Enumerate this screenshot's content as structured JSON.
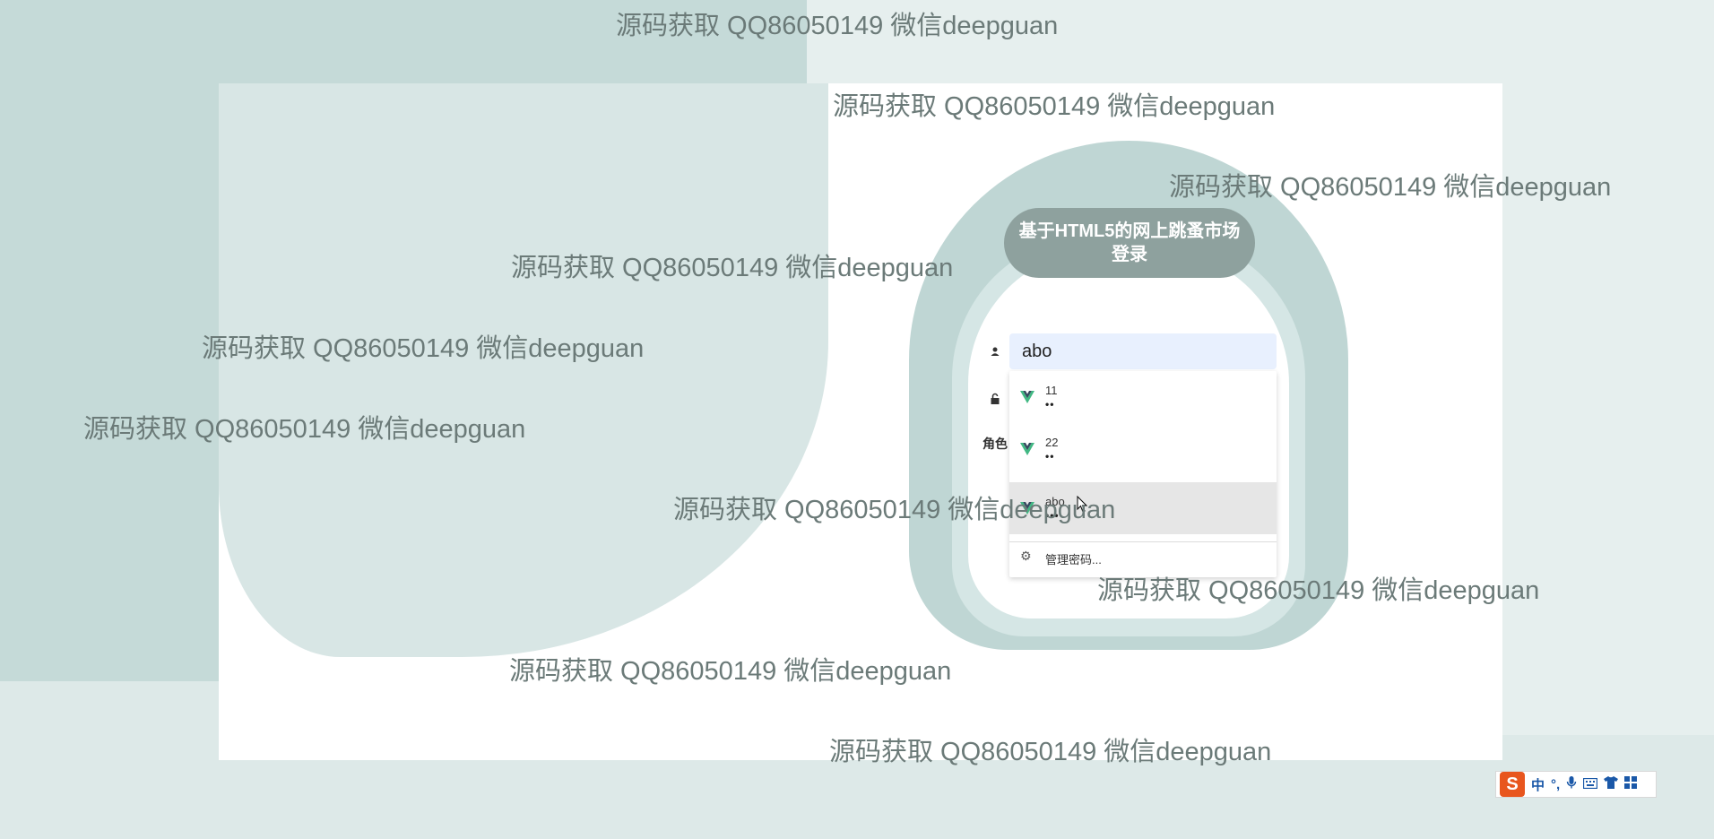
{
  "watermark_text": "源码获取 QQ86050149 微信deepguan",
  "login": {
    "title": "基于HTML5的网上跳蚤市场登录",
    "username_value": "abo",
    "role_label": "角色"
  },
  "autocomplete": {
    "items": [
      {
        "username": "11",
        "password_mask": "••"
      },
      {
        "username": "22",
        "password_mask": "••"
      },
      {
        "username": "abo",
        "password_mask": "•••"
      }
    ],
    "manage_label": "管理密码..."
  },
  "ime": {
    "logo": "S",
    "mode": "中",
    "punct": "°,",
    "icons": [
      "microphone-icon",
      "keyboard-icon",
      "shirt-icon",
      "toolbox-icon"
    ]
  },
  "colors": {
    "background": "#dde9e8",
    "title_pill": "#8ea19e",
    "frame": "#bfd6d4",
    "input_bg": "#e8f0fe",
    "vue_green": "#41b883"
  }
}
